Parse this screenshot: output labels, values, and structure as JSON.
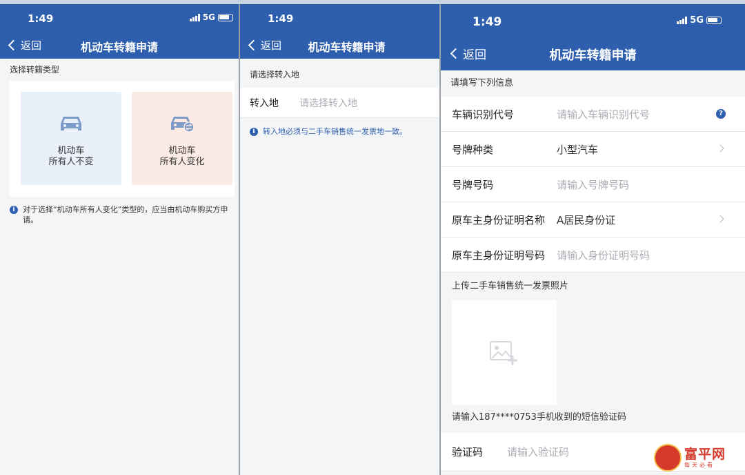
{
  "screens": [
    {
      "status": {
        "time": "1:49",
        "network": "5G"
      },
      "nav": {
        "back": "返回",
        "title": "机动车转籍申请"
      },
      "section_title": "选择转籍类型",
      "cards": [
        {
          "line1": "机动车",
          "line2": "所有人不变",
          "icon": "car-icon",
          "tint": "#eaf0f9"
        },
        {
          "line1": "机动车",
          "line2": "所有人变化",
          "icon": "car-transfer-icon",
          "tint": "#fbebe4"
        }
      ],
      "notice": "对于选择“机动车所有人变化”类型的，应当由机动车购买方申请。"
    },
    {
      "status": {
        "time": "1:49"
      },
      "nav": {
        "back": "返回",
        "title": "机动车转籍申请"
      },
      "section_title": "请选择转入地",
      "field": {
        "label": "转入地",
        "placeholder": "请选择转入地"
      },
      "notice": "转入地必须与二手车销售统一发票地一致。"
    },
    {
      "status": {
        "time": "1:49",
        "network": "5G"
      },
      "nav": {
        "back": "返回",
        "title": "机动车转籍申请"
      },
      "section_title": "请填写下列信息",
      "fields": [
        {
          "label": "车辆识别代号",
          "placeholder": "请输入车辆识别代号",
          "trailing": "help-icon"
        },
        {
          "label": "号牌种类",
          "value": "小型汽车",
          "trailing": "chevron-right-icon"
        },
        {
          "label": "号牌号码",
          "placeholder": "请输入号牌号码"
        },
        {
          "label": "原车主身份证明名称",
          "value": "A居民身份证",
          "trailing": "chevron-right-icon"
        },
        {
          "label": "原车主身份证明号码",
          "placeholder": "请输入身份证明号码"
        }
      ],
      "upload_label": "上传二手车销售统一发票照片",
      "sms_label": "请输入187****0753手机收到的短信验证码",
      "code_field": {
        "label": "验证码",
        "placeholder": "请输入验证码"
      }
    }
  ],
  "watermark": {
    "main": "富平网",
    "sub": "每天必看"
  },
  "colors": {
    "header": "#2e5fae",
    "background": "#f4f5f7",
    "placeholder": "#a9adb3"
  }
}
